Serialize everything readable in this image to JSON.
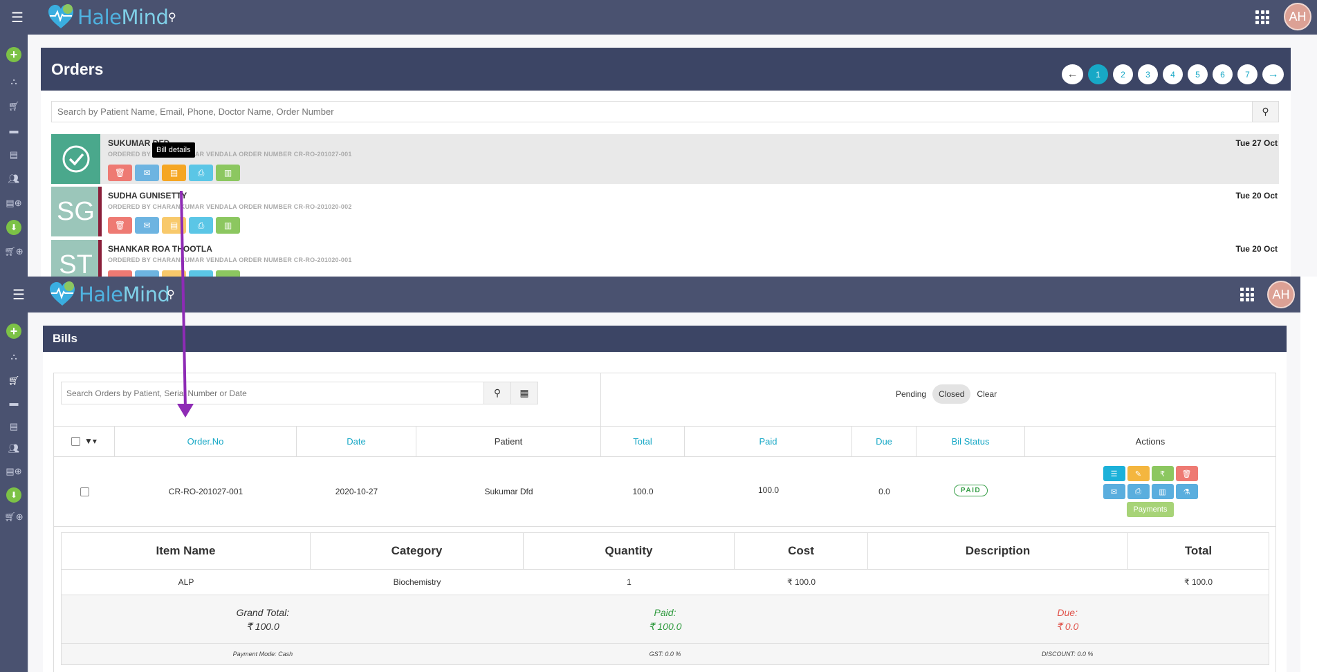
{
  "app": {
    "brand_hale": "Hale",
    "brand_mind": "Mind",
    "avatar_initials": "AH"
  },
  "orders": {
    "title": "Orders",
    "pager": {
      "prev": "←",
      "next": "→",
      "pages": [
        "1",
        "2",
        "3",
        "4",
        "5",
        "6",
        "7"
      ],
      "active": "1"
    },
    "search_placeholder": "Search by Patient Name, Email, Phone, Doctor Name, Order Number",
    "tooltip": "Bill details",
    "rows": [
      {
        "thumb": "",
        "name": "SUKUMAR DFD",
        "sub": "ORDERED BY CHARANKUMAR VENDALA ORDER NUMBER CR-RO-201027-001",
        "date": "Tue 27 Oct"
      },
      {
        "thumb": "SG",
        "name": "SUDHA GUNISETTY",
        "sub": "ORDERED BY CHARANKUMAR VENDALA ORDER NUMBER CR-RO-201020-002",
        "date": "Tue 20 Oct"
      },
      {
        "thumb": "ST",
        "name": "SHANKAR ROA THOOTLA",
        "sub": "ORDERED BY CHARANKUMAR VENDALA ORDER NUMBER CR-RO-201020-001",
        "date": "Tue 20 Oct"
      }
    ]
  },
  "bills": {
    "title": "Bills",
    "search_placeholder": "Search Orders by Patient, Serial Number or Date",
    "filters": [
      "Pending",
      "Closed",
      "Clear"
    ],
    "active_filter": "Closed",
    "columns": {
      "order_no": "Order.No",
      "date": "Date",
      "patient": "Patient",
      "total": "Total",
      "paid": "Paid",
      "due": "Due",
      "status": "Bil Status",
      "actions": "Actions"
    },
    "row": {
      "order_no": "CR-RO-201027-001",
      "date": "2020-10-27",
      "patient": "Sukumar Dfd",
      "total": "100.0",
      "paid": "100.0",
      "due": "0.0",
      "status": "PAID",
      "payments_label": "Payments"
    },
    "items": {
      "headers": {
        "name": "Item Name",
        "category": "Category",
        "quantity": "Quantity",
        "cost": "Cost",
        "description": "Description",
        "total": "Total"
      },
      "row": {
        "name": "ALP",
        "category": "Biochemistry",
        "quantity": "1",
        "cost": "₹ 100.0",
        "description": "",
        "total": "₹ 100.0"
      }
    },
    "totals": {
      "grand_label": "Grand Total:",
      "grand_value": "₹ 100.0",
      "paid_label": "Paid:",
      "paid_value": "₹ 100.0",
      "due_label": "Due:",
      "due_value": "₹ 0.0"
    },
    "footer": {
      "payment_mode": "Payment Mode: Cash",
      "gst": "GST: 0.0 %",
      "discount": "DISCOUNT: 0.0 %"
    }
  },
  "colors": {
    "header": "#3c4565",
    "topbar": "#4a5270",
    "accent": "#17a8c6",
    "arrow": "#8e2bb5"
  }
}
